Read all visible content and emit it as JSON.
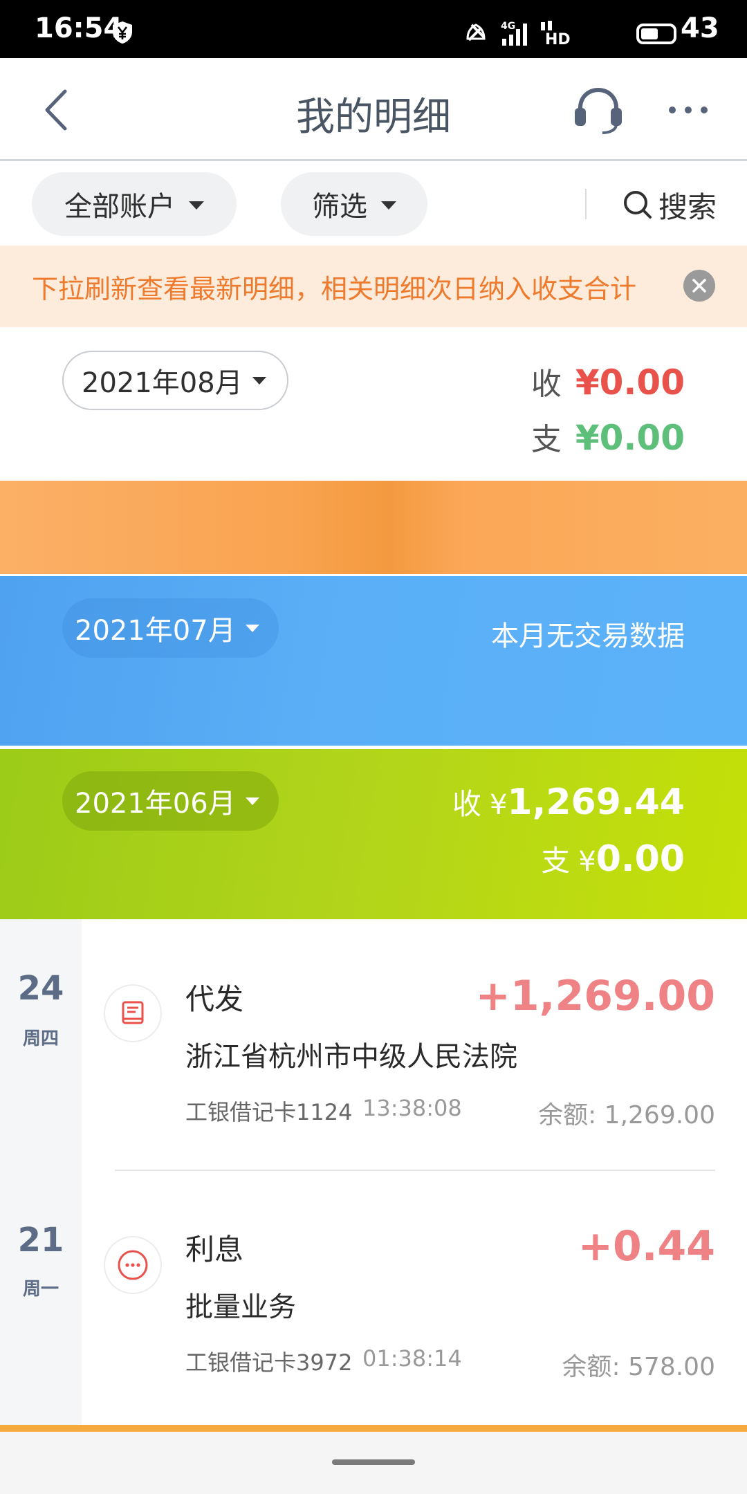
{
  "status_bar": {
    "time": "16:54",
    "battery": "43"
  },
  "header": {
    "title": "我的明细"
  },
  "filters": {
    "account_label": "全部账户",
    "filter_label": "筛选",
    "search_label": "搜索"
  },
  "notice": {
    "text": "下拉刷新查看最新明细，相关明细次日纳入收支合计"
  },
  "months": [
    {
      "label": "2021年08月",
      "income_label": "收",
      "income": "¥0.00",
      "expense_label": "支",
      "expense": "¥0.00"
    },
    {
      "label": "2021年07月",
      "no_data": "本月无交易数据"
    },
    {
      "label": "2021年06月",
      "income_label": "收",
      "income_currency": "¥",
      "income": "1,269.44",
      "expense_label": "支",
      "expense_currency": "¥",
      "expense": "0.00"
    }
  ],
  "transactions": [
    {
      "day": "24",
      "weekday": "周四",
      "type": "代发",
      "description": "浙江省杭州市中级人民法院",
      "card": "工银借记卡1124",
      "time": "13:38:08",
      "amount": "+1,269.00",
      "balance": "余额: 1,269.00",
      "icon": "payroll-icon"
    },
    {
      "day": "21",
      "weekday": "周一",
      "type": "利息",
      "description": "批量业务",
      "card": "工银借记卡3972",
      "time": "01:38:14",
      "amount": "+0.44",
      "balance": "余额: 578.00",
      "icon": "more-circle-icon"
    }
  ],
  "colors": {
    "income_red": "#e8524a",
    "expense_green": "#5dbf7a",
    "notice_orange": "#ee7a2d",
    "amount_pink": "#ef8284"
  }
}
